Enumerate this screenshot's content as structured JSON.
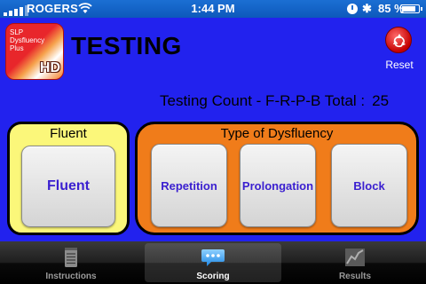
{
  "status": {
    "carrier": "ROGERS",
    "time": "1:44 PM",
    "battery_pct": "85 %",
    "battery_level": 0.85,
    "bluetooth_symbol": "✱"
  },
  "app": {
    "logo_text": "SLP\nDysfluency\nPlus",
    "logo_badge": "HD",
    "title": "TESTING",
    "reset_label": "Reset"
  },
  "count": {
    "label": "Testing Count - F-R-P-B Total :",
    "value": "25"
  },
  "panels": {
    "fluent_heading": "Fluent",
    "fluent_button": "Fluent",
    "type_heading": "Type of Dysfluency",
    "buttons": [
      "Repetition",
      "Prolongation",
      "Block"
    ]
  },
  "tabs": [
    {
      "label": "Instructions",
      "icon": "notepad-icon"
    },
    {
      "label": "Scoring",
      "icon": "speech-bubble-icon"
    },
    {
      "label": "Results",
      "icon": "chart-icon"
    }
  ],
  "colors": {
    "background": "#2222ee",
    "fluent_panel": "#fbf77a",
    "type_panel": "#f07c1a",
    "button_text": "#3a1fd0"
  }
}
